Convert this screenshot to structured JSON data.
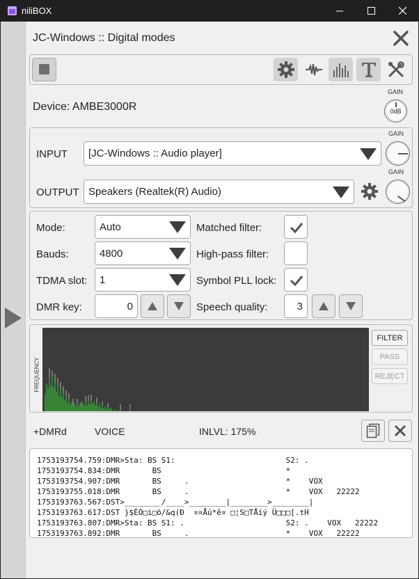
{
  "window": {
    "title": "niliBOX"
  },
  "header": {
    "title": "JC-Windows :: Digital modes"
  },
  "toolbar": {
    "icons": [
      "stop-icon",
      "gear-icon",
      "waveform-icon",
      "spectrum-bars-icon",
      "text-icon",
      "tools-icon"
    ]
  },
  "device": {
    "label": "Device: AMBE3000R",
    "gain_label": "GAIN",
    "gain_value": "0dB"
  },
  "io": {
    "input_label": "INPUT",
    "input_value": "[JC-Windows :: Audio player]",
    "output_label": "OUTPUT",
    "output_value": "Speakers (Realtek(R) Audio)",
    "gain_label": "GAIN"
  },
  "settings": {
    "mode_label": "Mode:",
    "mode_value": "Auto",
    "bauds_label": "Bauds:",
    "bauds_value": "4800",
    "tdma_label": "TDMA slot:",
    "tdma_value": "1",
    "dmrkey_label": "DMR key:",
    "dmrkey_value": "0",
    "matched_label": "Matched filter:",
    "matched_checked": true,
    "highpass_label": "High-pass filter:",
    "highpass_checked": false,
    "pll_label": "Symbol PLL lock:",
    "pll_checked": true,
    "speech_label": "Speech quality:",
    "speech_value": "3"
  },
  "spectrum": {
    "axis_label": "FREQUENCY",
    "filter_label": "FILTER",
    "pass_label": "PASS",
    "reject_label": "REJECT"
  },
  "status": {
    "mode": "+DMRd",
    "voice": "VOICE",
    "inlvl": "INLVL: 175%"
  },
  "log": [
    "1753193754.759:DMR>Sta: BS S1:                        S2: .",
    "1753193754.834:DMR       BS                           *",
    "1753193754.907:DMR       BS     .                     *    VOX",
    "1753193755.018:DMR       BS     .                     *    VOX   22222",
    "1753193763.567:DST>________/____>________|________>________|",
    "1753193763.617:DST }$ÈÒ□i□ö/&q(Ð  ¤¤Åú*ê¤ □¦S□TÅíý Ü□□□[.tH",
    "1753193763.807:DMR>Sta: BS S1: .                      S2: .    VOX   22222",
    "1753193763.892:DMR       BS     .                     *    VOX   22222"
  ],
  "colors": {
    "spectrum_bg": "#3b3b3b",
    "spectrum_signal": "#33cc33"
  }
}
